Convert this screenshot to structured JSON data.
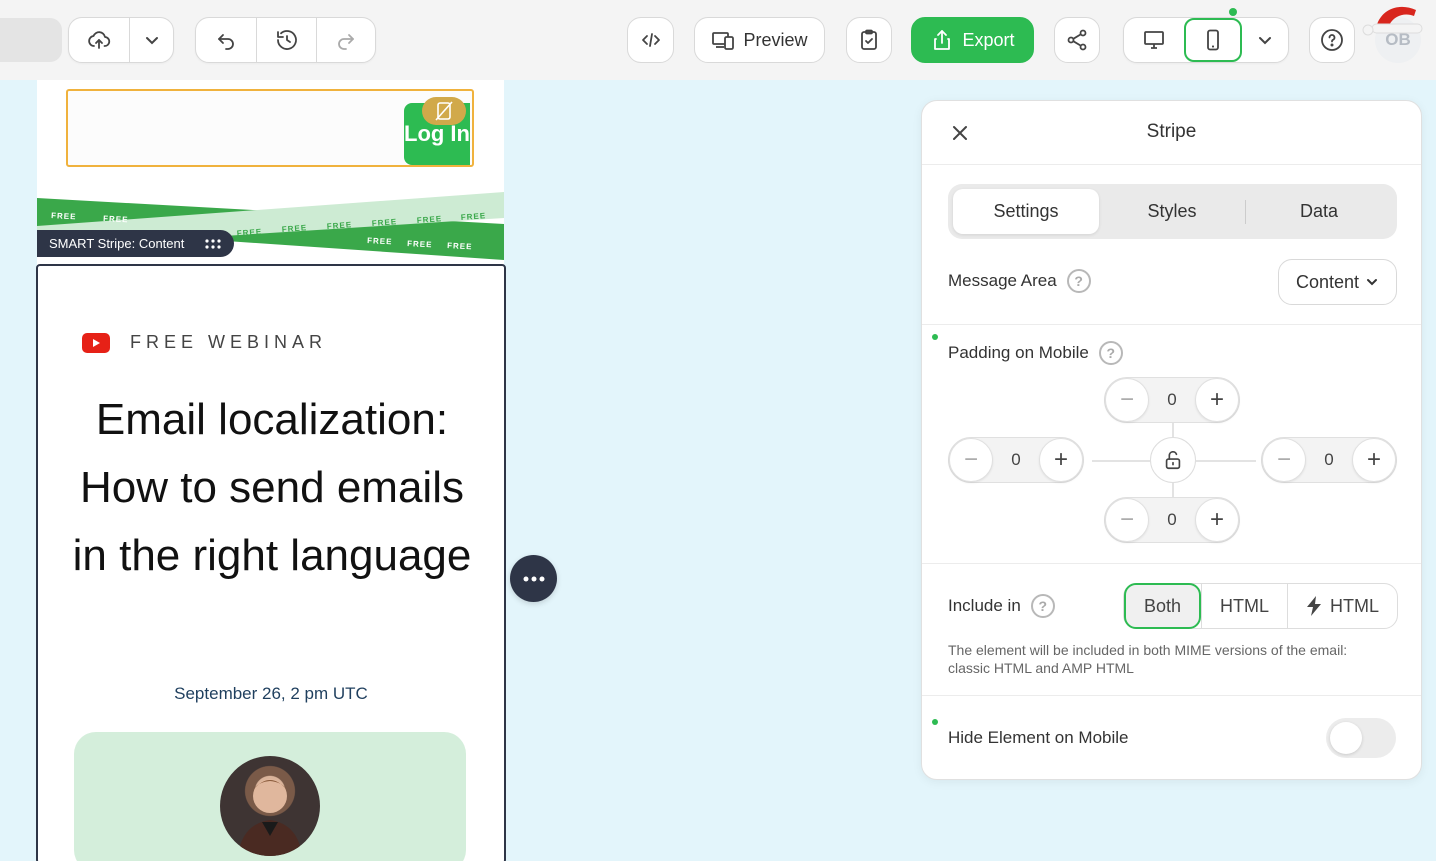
{
  "toolbar": {
    "preview_label": "Preview",
    "export_label": "Export",
    "avatar_initials": "OB",
    "accent_color": "#2dbb52"
  },
  "email": {
    "login_button": "Log In",
    "stripe_word": "FREE",
    "stripe_badge": "SMART Stripe: Content",
    "webinar_label": "FREE WEBINAR",
    "title": "Email localization: How to send emails in the right language",
    "date": "September 26, 2 pm UTC"
  },
  "panel": {
    "title": "Stripe",
    "tabs": [
      {
        "label": "Settings",
        "active": true
      },
      {
        "label": "Styles",
        "active": false
      },
      {
        "label": "Data",
        "active": false
      }
    ],
    "message_area": {
      "label": "Message Area",
      "value": "Content"
    },
    "padding": {
      "label": "Padding on Mobile",
      "top": "0",
      "left": "0",
      "right": "0",
      "bottom": "0"
    },
    "include_in": {
      "label": "Include in",
      "options": [
        "Both",
        "HTML",
        "HTML"
      ],
      "selected": "Both",
      "note": "The element will be included in both MIME versions of the email: classic HTML and AMP HTML"
    },
    "hide_on_mobile": {
      "label": "Hide Element on Mobile",
      "enabled": false
    }
  }
}
